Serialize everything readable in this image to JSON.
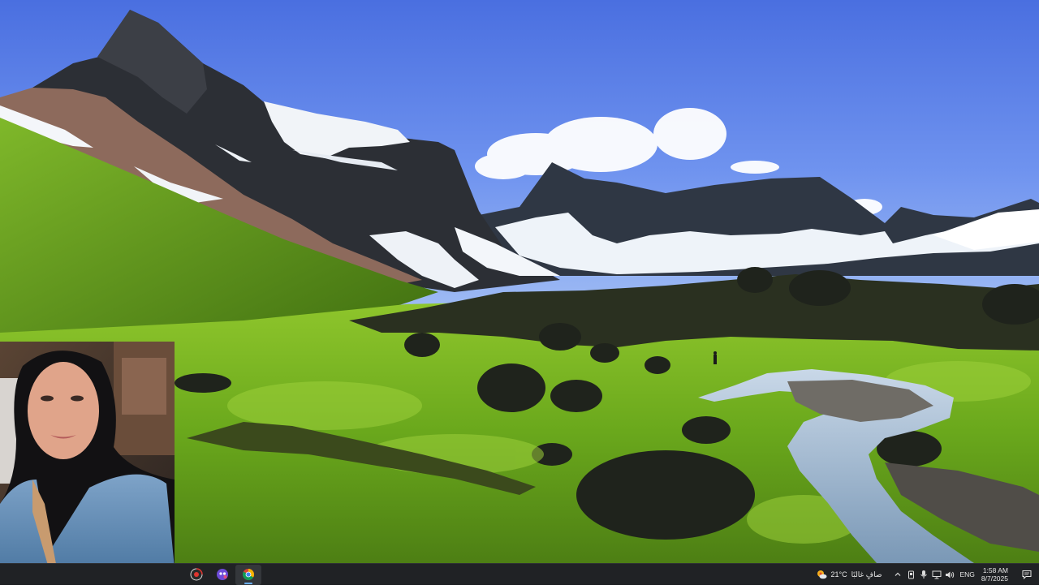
{
  "desktop": {
    "wallpaper": "mountain-valley-landscape"
  },
  "webcam": {
    "description_icon": "person-webcam-feed"
  },
  "taskbar": {
    "apps": [
      {
        "name": "obs-studio",
        "icon": "record-icon",
        "active": false
      },
      {
        "name": "app-launcher",
        "icon": "purple-app-icon",
        "active": false
      },
      {
        "name": "chrome",
        "icon": "chrome-icon",
        "active": true
      }
    ],
    "weather": {
      "temperature": "21°C",
      "condition": "صافٍ غالبًا",
      "icon": "weather-sun-icon"
    },
    "tray": {
      "language": "ENG",
      "time": "1:58 AM",
      "date": "8/7/2025"
    }
  },
  "colors": {
    "taskbar_bg": "#202225",
    "accent": "#6bb0ff"
  }
}
